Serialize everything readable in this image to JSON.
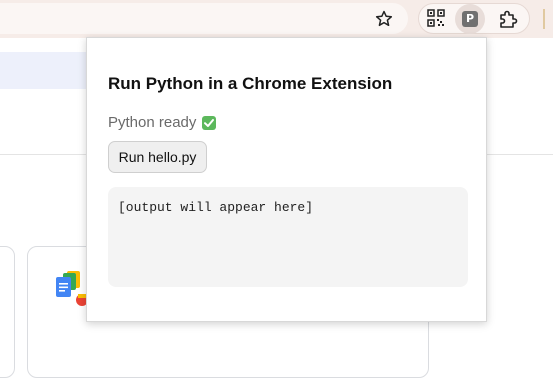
{
  "toolbar": {
    "extension_badge": "P",
    "icons": [
      "star-icon",
      "qr-code-icon",
      "python-extension-icon",
      "puzzle-icon"
    ]
  },
  "popup": {
    "title": "Run Python in a Chrome Extension",
    "status_text": "Python ready",
    "status_icon": "check-icon",
    "run_button_label": "Run hello.py",
    "output_text": "[output will appear here]"
  },
  "colors": {
    "toolbar_bg": "#f6ece8",
    "check_green": "#5cb85c",
    "output_bg": "#f4f4f4"
  }
}
